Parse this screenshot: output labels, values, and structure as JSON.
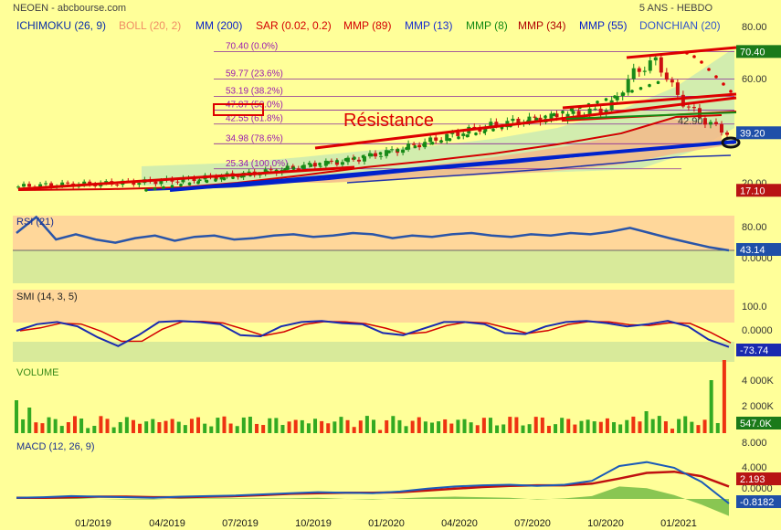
{
  "header": {
    "left_title": "NEOEN - abcbourse.com",
    "right_title": "5 ANS - HEBDO"
  },
  "indicator_legend": [
    {
      "label": "ICHIMOKU (26, 9)",
      "color": "#0b2fa8"
    },
    {
      "label": "BOLL (20, 2)",
      "color": "#f08c64"
    },
    {
      "label": "MM (200)",
      "color": "#0b22c8"
    },
    {
      "label": "SAR (0.02, 0.2)",
      "color": "#d40000"
    },
    {
      "label": "MMP (89)",
      "color": "#d40000"
    },
    {
      "label": "MMP (13)",
      "color": "#1a2fd0"
    },
    {
      "label": "MMP (8)",
      "color": "#138a13"
    },
    {
      "label": "MMP (34)",
      "color": "#b00000"
    },
    {
      "label": "MMP (55)",
      "color": "#0b22c8"
    },
    {
      "label": "DONCHIAN (20)",
      "color": "#3355cc"
    }
  ],
  "annotation": {
    "text": "Résistance",
    "color": "#dd0000"
  },
  "fibonacci": [
    {
      "price": 70.4,
      "label": "70.40  (0.0%)"
    },
    {
      "price": 59.77,
      "label": "59.77  (23.6%)"
    },
    {
      "price": 53.19,
      "label": "53.19  (38.2%)"
    },
    {
      "price": 47.87,
      "label": "47.87  (50.0%)"
    },
    {
      "price": 42.55,
      "label": "42.55  (61.8%)"
    },
    {
      "price": 34.98,
      "label": "34.98  (78.6%)"
    },
    {
      "price": 25.34,
      "label": "25.34  (100.0%)"
    }
  ],
  "x_axis_labels": [
    "01/2019",
    "04/2019",
    "07/2019",
    "10/2019",
    "01/2020",
    "04/2020",
    "07/2020",
    "10/2020",
    "01/2021"
  ],
  "chart_data": [
    {
      "type": "candlestick",
      "title": "NEOEN - abcbourse.com",
      "y_ticks": [
        80.0,
        60.0,
        40.0,
        20.0
      ],
      "y_tick_labels": [
        "80.00",
        "60.00",
        "40.00",
        "20.00"
      ],
      "ylim": [
        14,
        82
      ],
      "badges": [
        {
          "text": "70.40",
          "value": 70.4,
          "color": "#1a7a1a"
        },
        {
          "text": "39.20",
          "value": 39.2,
          "color": "#1f4fa8"
        },
        {
          "text": "17.10",
          "value": 17.1,
          "color": "#b81414"
        }
      ],
      "inline_value_label": {
        "text": "42.90",
        "value": 42.9
      },
      "close_approx": [
        18.5,
        19.0,
        19.3,
        19.5,
        19.9,
        20.2,
        20.6,
        21.2,
        22.0,
        22.8,
        23.7,
        24.8,
        26.3,
        27.5,
        28.5,
        30.5,
        32.5,
        35.0,
        37.5,
        40.0,
        42.0,
        43.5,
        44.5,
        45.5,
        47.0,
        48.5,
        62.0,
        67.0,
        52.0,
        44.0,
        39.2
      ],
      "period": {
        "start": "01/2019",
        "end": "01/2021"
      }
    },
    {
      "type": "line",
      "title": "RSI (21)",
      "y_tick_labels": [
        "80.00",
        "0.0000"
      ],
      "last_value": "43.14",
      "approx_values": [
        70,
        95,
        60,
        68,
        60,
        55,
        62,
        66,
        58,
        64,
        66,
        60,
        62,
        66,
        68,
        64,
        66,
        70,
        68,
        62,
        66,
        64,
        68,
        70,
        66,
        64,
        68,
        66,
        70,
        68,
        72,
        78,
        70,
        62,
        55,
        48,
        43
      ]
    },
    {
      "type": "line",
      "title": "SMI (14, 3, 5)",
      "y_tick_labels": [
        "100.0",
        "0.0000"
      ],
      "last_value": "-73.74",
      "approx_values": [
        0,
        30,
        40,
        20,
        -30,
        -70,
        -20,
        40,
        45,
        40,
        30,
        -20,
        -25,
        20,
        40,
        45,
        35,
        30,
        -10,
        -20,
        10,
        40,
        40,
        30,
        -10,
        -15,
        20,
        40,
        45,
        35,
        20,
        30,
        45,
        20,
        -40,
        -73.74
      ]
    },
    {
      "type": "bar",
      "title": "VOLUME",
      "y_tick_labels": [
        "4 000K",
        "2 000K"
      ],
      "last_value": "547.0K",
      "note": "volume bars green/red, spike near end ~4 300K"
    },
    {
      "type": "line",
      "title": "MACD (12, 26, 9)",
      "y_tick_labels": [
        "8.000",
        "4.000",
        "0.0000"
      ],
      "last_values": [
        "2.193",
        "-0.8182"
      ],
      "approx_macd": [
        0.2,
        0.3,
        0.5,
        0.4,
        0.3,
        0.2,
        0.4,
        0.5,
        0.6,
        0.8,
        1.0,
        1.2,
        1.1,
        1.0,
        1.3,
        1.8,
        2.2,
        2.4,
        2.5,
        2.3,
        2.5,
        3.2,
        5.8,
        6.5,
        5.5,
        3.0,
        -0.8
      ],
      "approx_signal": [
        0.2,
        0.2,
        0.3,
        0.4,
        0.4,
        0.3,
        0.3,
        0.4,
        0.5,
        0.7,
        0.9,
        1.0,
        1.1,
        1.1,
        1.2,
        1.5,
        1.8,
        2.1,
        2.3,
        2.4,
        2.4,
        2.7,
        3.6,
        4.6,
        4.8,
        4.0,
        2.2
      ]
    }
  ]
}
